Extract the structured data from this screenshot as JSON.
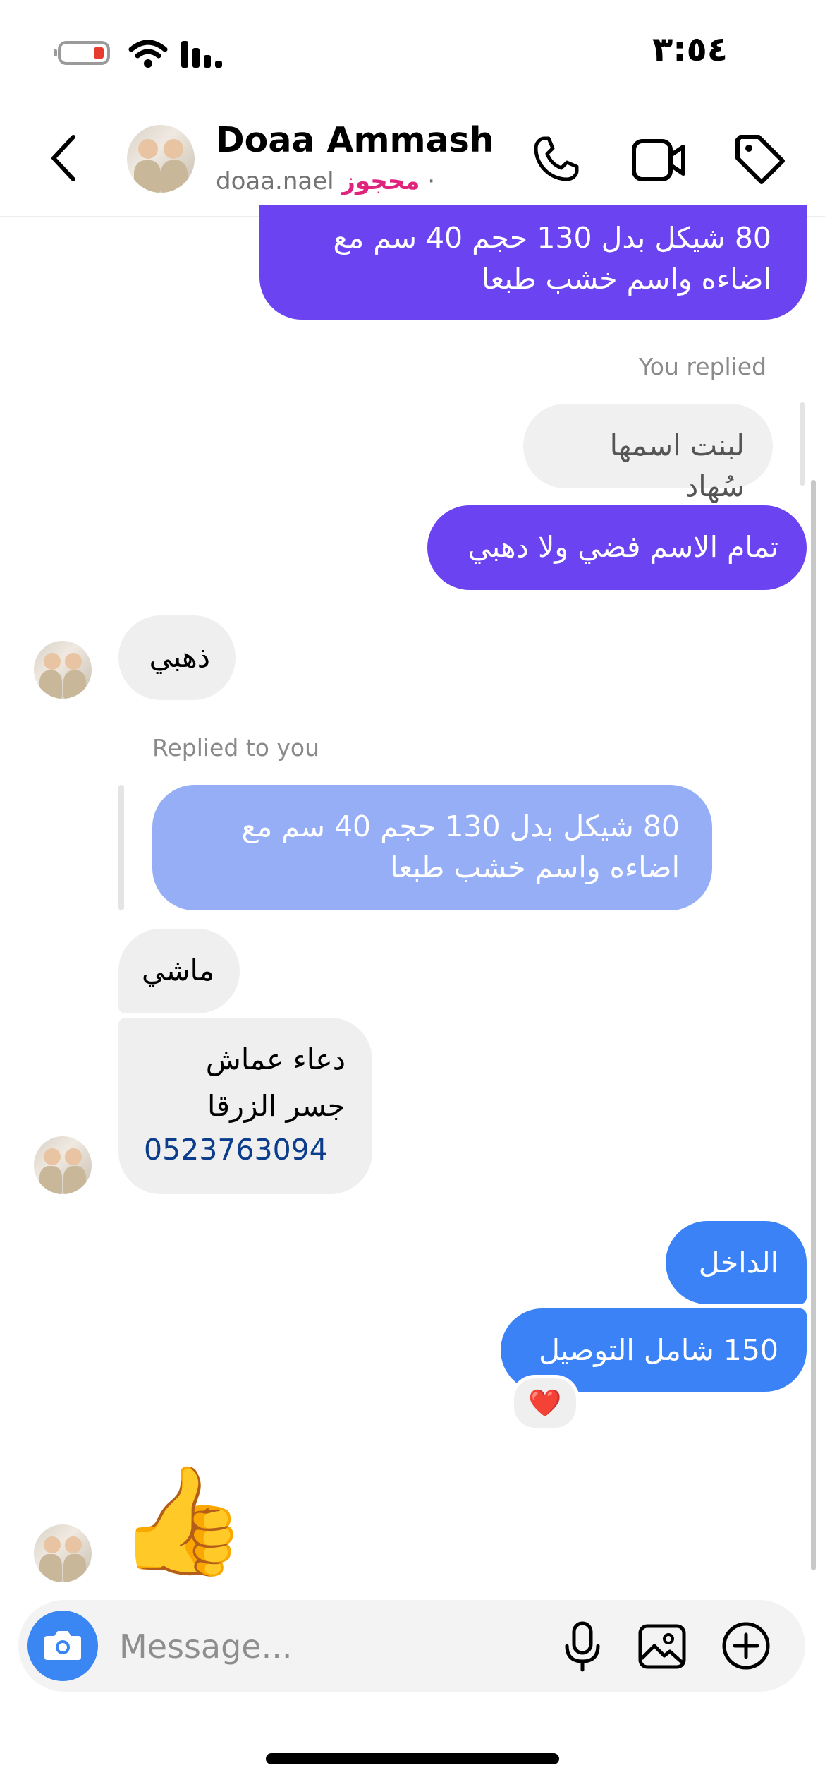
{
  "status_bar": {
    "time": "٣:٥٤"
  },
  "header": {
    "name": "Doaa Ammash",
    "username": "doaa.nael",
    "status": "محجوز",
    "separator": "·"
  },
  "messages": {
    "m1_text": "80 شيكل بدل 130  حجم 40 سم مع اضاءه واسم  خشب طبعا",
    "you_replied_caption": "You replied",
    "quoted_reply_text": "لبنت اسمها سُهاد",
    "m2_text": "تمام الاسم فضي ولا دهبي",
    "m3_text": "ذهبي",
    "replied_to_you_caption": "Replied to you",
    "quoted_out_text": "80 شيكل بدل 130  حجم 40 سم مع اضاءه واسم  خشب طبعا",
    "m4_text": "ماشي",
    "m5_line1": "دعاء عماش",
    "m5_line2": "جسر الزرقا",
    "m5_phone": "0523763094",
    "m6_text": "الداخل",
    "m7_text": "150 شامل التوصيل",
    "m7_reaction": "❤️",
    "m8_emoji": "👍"
  },
  "composer": {
    "placeholder": "Message..."
  },
  "colors": {
    "outgoing_purple": "#6b43f0",
    "outgoing_blue": "#3b82f6",
    "incoming_gray": "#efefef",
    "status_pink": "#e0247d",
    "camera_button": "#3a86f2"
  },
  "icons": [
    "back-icon",
    "phone-icon",
    "video-icon",
    "tag-icon",
    "camera-icon",
    "microphone-icon",
    "gallery-icon",
    "plus-icon",
    "wifi-icon",
    "signal-icon",
    "battery-icon"
  ]
}
